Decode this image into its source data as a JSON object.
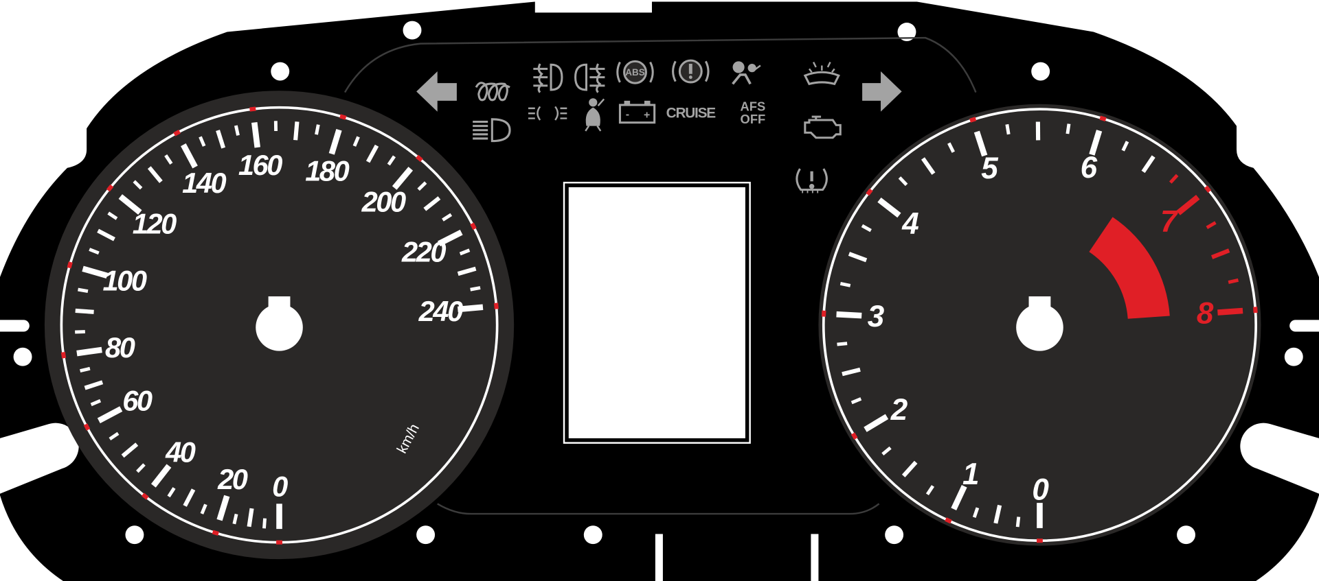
{
  "colors": {
    "plate": "#000000",
    "dial": "#2a2827",
    "markings": "#ffffff",
    "accent_red": "#e01f26",
    "indicator_gray": "#a3a3a3",
    "display_window": "#ffffff"
  },
  "speedometer": {
    "unit": "km/h",
    "min": 0,
    "max": 240,
    "major_step": 20,
    "minor_step": 5,
    "labels": [
      "0",
      "20",
      "40",
      "60",
      "80",
      "100",
      "120",
      "140",
      "160",
      "180",
      "200",
      "220",
      "240"
    ]
  },
  "tachometer": {
    "min": 0,
    "max": 8,
    "major_step": 1,
    "minor_step": 0.25,
    "labels": [
      "0",
      "1",
      "2",
      "3",
      "4",
      "5",
      "6",
      "7",
      "8"
    ],
    "red_labels": [
      "7",
      "8"
    ],
    "redline_start": 6.5,
    "redline_end": 8
  },
  "indicators": {
    "turn_left": "arrow-left-icon",
    "turn_right": "arrow-right-icon",
    "glow_plug": "glow-plug-icon",
    "high_beam": "high-beam-icon",
    "front_fog": "front-fog-light-icon",
    "rear_fog": "rear-fog-light-icon",
    "abs_label": "ABS",
    "brake": "brake-warning-icon",
    "airbag": "airbag-icon",
    "position_lights": "position-lights-icon",
    "seatbelt": "seatbelt-icon",
    "battery_minus": "-",
    "battery_plus": "+",
    "cruise_label": "CRUISE",
    "afs_line1": "AFS",
    "afs_line2": "OFF",
    "washer": "washer-fluid-icon",
    "check_engine": "check-engine-icon",
    "tpms": "tire-pressure-icon"
  }
}
